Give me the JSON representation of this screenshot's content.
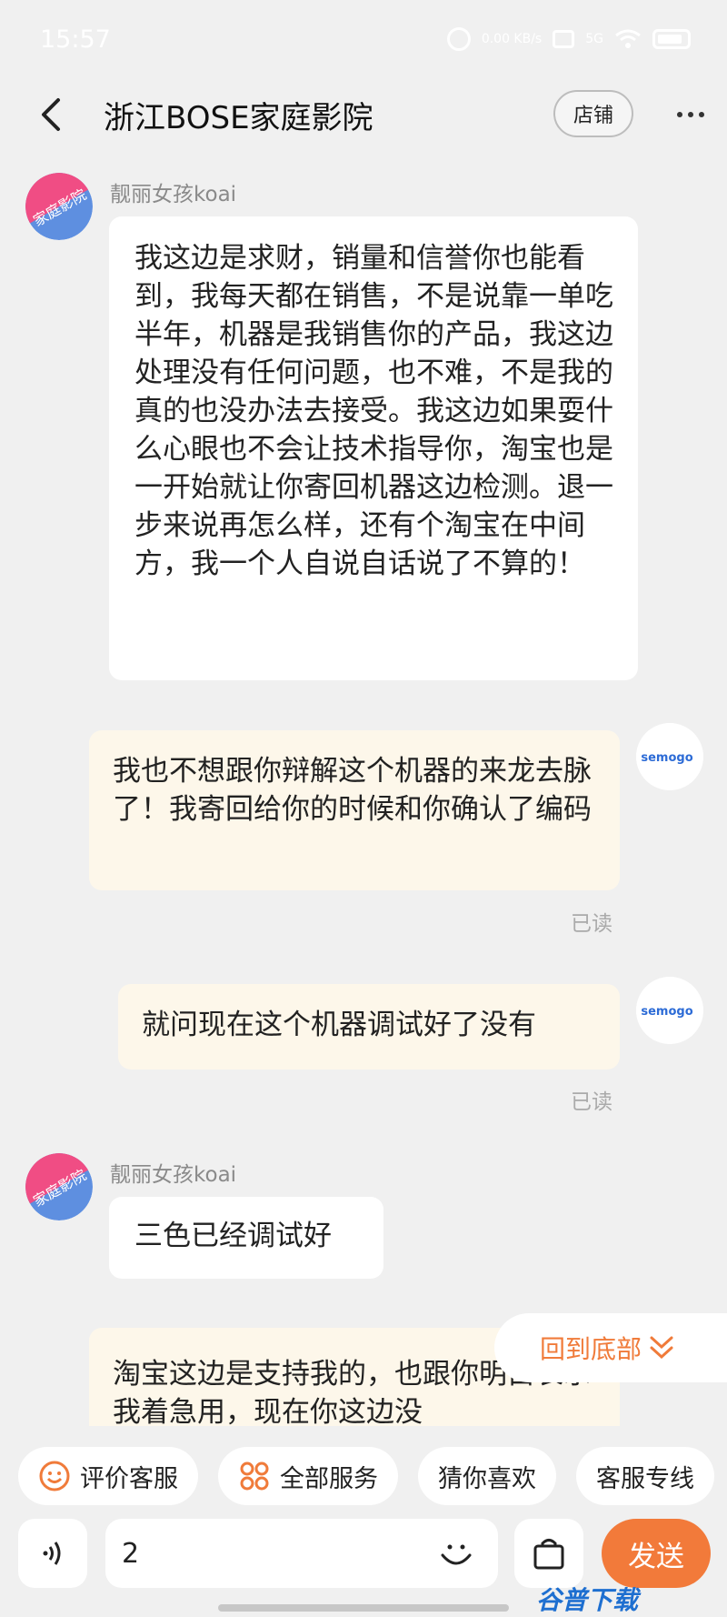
{
  "status_bar": {
    "time": "15:57",
    "net_speed": "0.00 KB/s",
    "signal": "5G"
  },
  "header": {
    "title": "浙江BOSE家庭影院",
    "shop_label": "店铺"
  },
  "messages": [
    {
      "sender": "靓丽女孩koai",
      "text": "我这边是求财，销量和信誉你也能看到，我每天都在销售，不是说靠一单吃半年，机器是我销售你的产品，我这边处理没有任何问题，也不难，不是我的真的也没办法去接受。我这边如果耍什么心眼也不会让技术指导你，淘宝也是一开始就让你寄回机器这边检测。退一步来说再怎么样，还有个淘宝在中间方，我一个人自说自话说了不算的！"
    },
    {
      "text": "我也不想跟你辩解这个机器的来龙去脉了！我寄回给你的时候和你确认了编码",
      "read": "已读"
    },
    {
      "text": "就问现在这个机器调试好了没有",
      "read": "已读"
    },
    {
      "sender": "靓丽女孩koai",
      "text": "三色已经调试好"
    },
    {
      "text": "淘宝这边是支持我的，也跟你明白表示我着急用，现在你这边没"
    }
  ],
  "back_to_bottom": "回到底部",
  "quick_actions": [
    "评价客服",
    "全部服务",
    "猜你喜欢",
    "客服专线"
  ],
  "input": {
    "value": "2",
    "send_label": "发送"
  },
  "watermark": "谷普下载",
  "colors": {
    "accent": "#f27a3a",
    "bubble_self": "#fdf7ea",
    "background": "#f0f0f0"
  },
  "avatars": {
    "shop_avatar_text": "家庭影院",
    "user_avatar_text": "semogo"
  }
}
